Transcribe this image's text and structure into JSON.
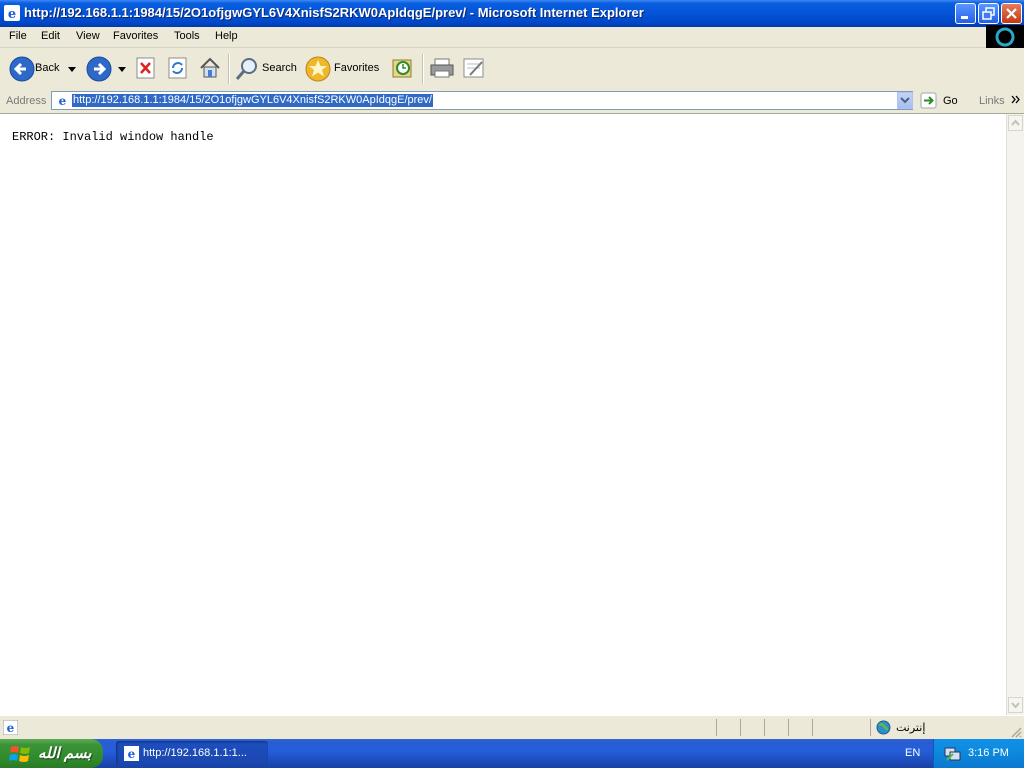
{
  "window": {
    "title": "http://192.168.1.1:1984/15/2O1ofjgwGYL6V4XnisfS2RKW0ApIdqgE/prev/ - Microsoft Internet Explorer"
  },
  "menu": [
    "File",
    "Edit",
    "View",
    "Favorites",
    "Tools",
    "Help"
  ],
  "toolbar": {
    "back_label": "Back",
    "search_label": "Search",
    "favorites_label": "Favorites"
  },
  "address": {
    "label": "Address",
    "url": "http://192.168.1.1:1984/15/2O1ofjgwGYL6V4XnisfS2RKW0ApIdqgE/prev/",
    "go_label": "Go",
    "links_label": "Links"
  },
  "content": {
    "error_text": "ERROR: Invalid window handle"
  },
  "statusbar": {
    "zone_label": "إنترنت"
  },
  "taskbar": {
    "start_label": "بسم الله",
    "task_label": "http://192.168.1.1:1...",
    "language": "EN",
    "clock": "3:16 PM"
  }
}
